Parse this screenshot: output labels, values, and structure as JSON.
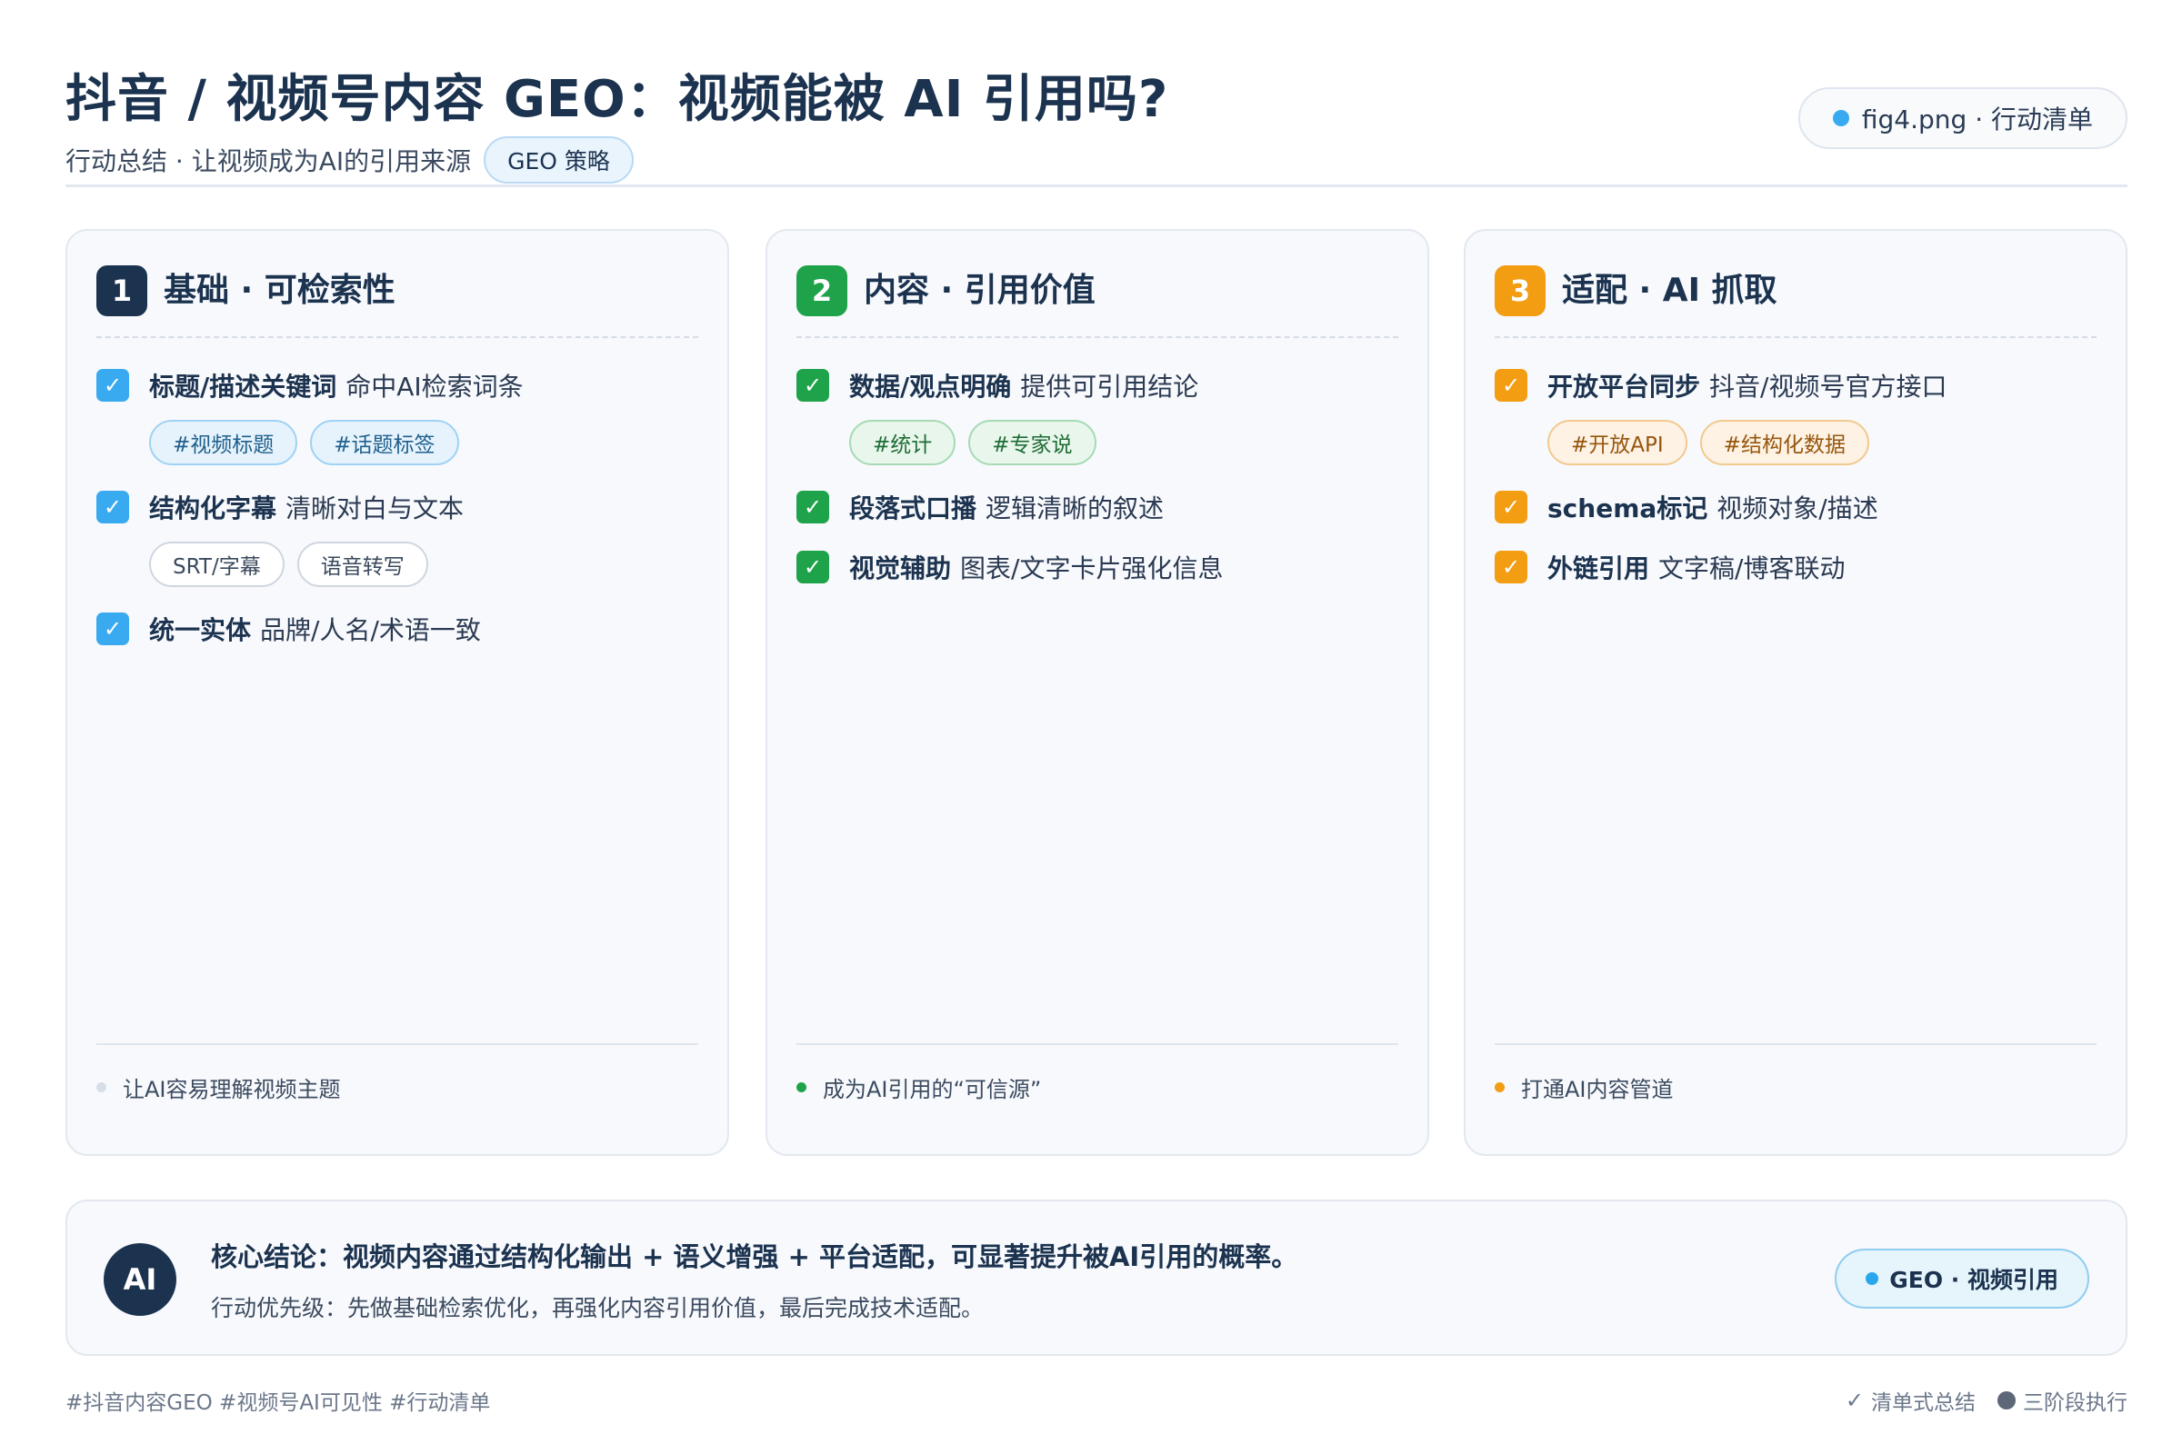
{
  "header": {
    "title": "抖音 / 视频号内容 GEO：视频能被 AI 引用吗?",
    "subtitle": "行动总结 · 让视频成为AI的引用来源",
    "badge": "GEO 策略",
    "file_label": "fig4.png · 行动清单"
  },
  "colors": {
    "navy": "#1c3350",
    "blue": "#3aaaf0",
    "green": "#1fa34a",
    "orange": "#f29d12"
  },
  "columns": [
    {
      "number": "1",
      "title": "基础 · 可检索性",
      "items": [
        {
          "bold": "标题/描述关键词",
          "rest": "命中AI检索词条",
          "tags": [
            "#视频标题",
            "#话题标签"
          ]
        },
        {
          "bold": "结构化字幕",
          "rest": "清晰对白与文本",
          "tags": [
            "SRT/字幕",
            "语音转写"
          ]
        },
        {
          "bold": "统一实体",
          "rest": "品牌/人名/术语一致"
        }
      ],
      "footer": "让AI容易理解视频主题"
    },
    {
      "number": "2",
      "title": "内容 · 引用价值",
      "items": [
        {
          "bold": "数据/观点明确",
          "rest": "提供可引用结论",
          "tags": [
            "#统计",
            "#专家说"
          ]
        },
        {
          "bold": "段落式口播",
          "rest": "逻辑清晰的叙述"
        },
        {
          "bold": "视觉辅助",
          "rest": "图表/文字卡片强化信息"
        }
      ],
      "footer": "成为AI引用的“可信源”"
    },
    {
      "number": "3",
      "title": "适配 · AI 抓取",
      "items": [
        {
          "bold": "开放平台同步",
          "rest": "抖音/视频号官方接口",
          "tags": [
            "#开放API",
            "#结构化数据"
          ]
        },
        {
          "bold": "schema标记",
          "rest": "视频对象/描述"
        },
        {
          "bold": "外链引用",
          "rest": "文字稿/博客联动"
        }
      ],
      "footer": "打通AI内容管道"
    }
  ],
  "conclusion": {
    "badge": "AI",
    "main": "核心结论：视频内容通过结构化输出 + 语义增强 + 平台适配，可显著提升被AI引用的概率。",
    "sub": "行动优先级：先做基础检索优化，再强化内容引用价值，最后完成技术适配。",
    "pill": "GEO · 视频引用"
  },
  "footer": {
    "hashtags": "#抖音内容GEO #视频号AI可见性 #行动清单",
    "check_icon": "✓",
    "summary_label": "清单式总结",
    "phase_label": "三阶段执行"
  }
}
